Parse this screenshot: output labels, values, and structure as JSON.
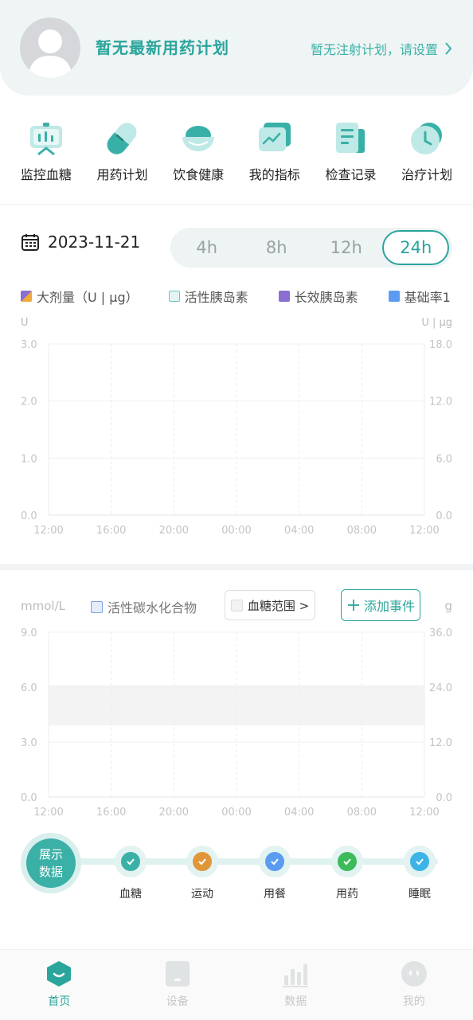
{
  "header": {
    "plan_title": "暂无最新用药计划",
    "injection_link": "暂无注射计划，请设置"
  },
  "features": [
    {
      "label": "监控血糖",
      "icon": "monitor-chart-icon"
    },
    {
      "label": "用药计划",
      "icon": "pill-icon"
    },
    {
      "label": "饮食健康",
      "icon": "bowl-icon"
    },
    {
      "label": "我的指标",
      "icon": "indicator-icon"
    },
    {
      "label": "检查记录",
      "icon": "document-icon"
    },
    {
      "label": "治疗计划",
      "icon": "clock-icon"
    }
  ],
  "date": "2023-11-21",
  "ranges": [
    "4h",
    "8h",
    "12h",
    "24h"
  ],
  "selected_range": "24h",
  "insulin_chart": {
    "legend": [
      {
        "label": "大剂量（U | μg）",
        "color": "#e07bb0"
      },
      {
        "label": "活性胰岛素",
        "color": "#d7f0ee"
      },
      {
        "label": "长效胰岛素",
        "color": "#8a6fd0"
      },
      {
        "label": "基础率1",
        "color": "#5b9cf0"
      }
    ],
    "left_unit": "U",
    "right_unit": "U | μg",
    "left_ticks": [
      "3.0",
      "2.0",
      "1.0",
      "0.0"
    ],
    "right_ticks": [
      "18.0",
      "12.0",
      "6.0",
      "0.0"
    ],
    "x_ticks": [
      "12:00",
      "16:00",
      "20:00",
      "00:00",
      "04:00",
      "08:00",
      "12:00"
    ]
  },
  "glucose_chart": {
    "left_unit": "mmol/L",
    "right_unit": "g",
    "carb_legend": "活性碳水化合物",
    "range_select": "血糖范围 >",
    "add_event": "添加事件",
    "left_ticks": [
      "9.0",
      "6.0",
      "3.0",
      "0.0"
    ],
    "right_ticks": [
      "36.0",
      "24.0",
      "12.0",
      "0.0"
    ],
    "x_ticks": [
      "12:00",
      "16:00",
      "20:00",
      "00:00",
      "04:00",
      "08:00",
      "12:00"
    ],
    "target_range": [
      3.9,
      6.1
    ]
  },
  "timeline": {
    "show_data_line1": "展示",
    "show_data_line2": "数据",
    "events": [
      {
        "label": "血糖",
        "color": "#3bb0a7"
      },
      {
        "label": "运动",
        "color": "#e0973a"
      },
      {
        "label": "用餐",
        "color": "#5b9cf0"
      },
      {
        "label": "用药",
        "color": "#3dbb5a"
      },
      {
        "label": "睡眠",
        "color": "#3cb4e6"
      }
    ]
  },
  "tabbar": [
    {
      "label": "首页",
      "icon": "home-icon"
    },
    {
      "label": "设备",
      "icon": "device-icon"
    },
    {
      "label": "数据",
      "icon": "data-bars-icon"
    },
    {
      "label": "我的",
      "icon": "profile-icon"
    }
  ]
}
